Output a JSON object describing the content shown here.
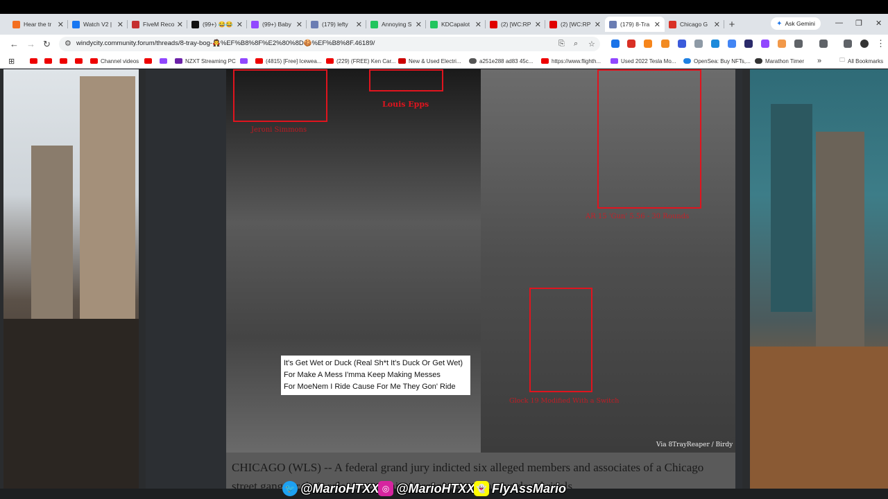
{
  "tabs": [
    {
      "title": "Hear the tr",
      "color": "#f36f21"
    },
    {
      "title": "Watch V2 |",
      "color": "#1877f2"
    },
    {
      "title": "FiveM Reco",
      "color": "#c53030"
    },
    {
      "title": "(99+) 😂😂",
      "color": "#111111"
    },
    {
      "title": "(99+) Baby",
      "color": "#9147ff"
    },
    {
      "title": "(179) lefty",
      "color": "#6b7db3"
    },
    {
      "title": "Annoying S",
      "color": "#22c55e"
    },
    {
      "title": "KDCapalot",
      "color": "#22c55e"
    },
    {
      "title": "(2) [WC:RP",
      "color": "#e00000"
    },
    {
      "title": "(2) [WC:RP",
      "color": "#e00000"
    },
    {
      "title": "(179) 8-Tra",
      "color": "#6b7db3"
    },
    {
      "title": "Chicago G",
      "color": "#d93025"
    }
  ],
  "active_tab_index": 10,
  "ask_gemini": "Ask Gemini",
  "url": "windycity.community.forum/threads/8-tray-bog-🧛%EF%B8%8F%E2%80%8D🍪%EF%B8%8F.46189/",
  "bookmarks": [
    {
      "label": "",
      "type": "yt"
    },
    {
      "label": "",
      "type": "yt"
    },
    {
      "label": "",
      "type": "yt"
    },
    {
      "label": "",
      "type": "yt"
    },
    {
      "label": "Channel videos",
      "type": "yt"
    },
    {
      "label": "",
      "type": "yt"
    },
    {
      "label": "",
      "type": "tw"
    },
    {
      "label": "NZXT Streaming PC",
      "type": "nzxt"
    },
    {
      "label": "",
      "type": "tw"
    },
    {
      "label": "(4815) [Free] Icewea...",
      "type": "yt"
    },
    {
      "label": "(229) (FREE) Ken Car...",
      "type": "yt"
    },
    {
      "label": "New & Used Electri...",
      "type": "tesla"
    },
    {
      "label": "a251e288 ad83 45c...",
      "type": "globe"
    },
    {
      "label": "https://www.flighth...",
      "type": "yt"
    },
    {
      "label": "Used 2022 Tesla Mo...",
      "type": "tw"
    },
    {
      "label": "OpenSea: Buy NFTs,...",
      "type": "opensea"
    },
    {
      "label": "Marathon Timer",
      "type": "timer"
    }
  ],
  "all_bookmarks": "All Bookmarks",
  "photo": {
    "labels": {
      "top_left": "Jeroni Simmons",
      "louis": "Louis Epps",
      "gun": "AR 15 'Gun' 5.56 - 30 Rounds",
      "glock": "Glock 19 Modified With a Switch"
    },
    "lyrics": [
      "It's Get Wet or Duck (Real Sh*t It's Duck Or Get Wet)",
      "For Make A Mess I'mma Keep Making Messes",
      "For MoeNem I Ride Cause For Me They Gon' Ride"
    ],
    "credit": "Via 8TrayReaper / Birdy"
  },
  "article_text": "CHICAGO (WLS) -- A federal grand jury indicted six alleged members and associates of a Chicago street gang for their roles in a criminal organization that murdered rivals",
  "social": {
    "twitter": "@MarioHTXX",
    "instagram": "@MarioHTXX",
    "snapchat": "FlyAssMario"
  }
}
